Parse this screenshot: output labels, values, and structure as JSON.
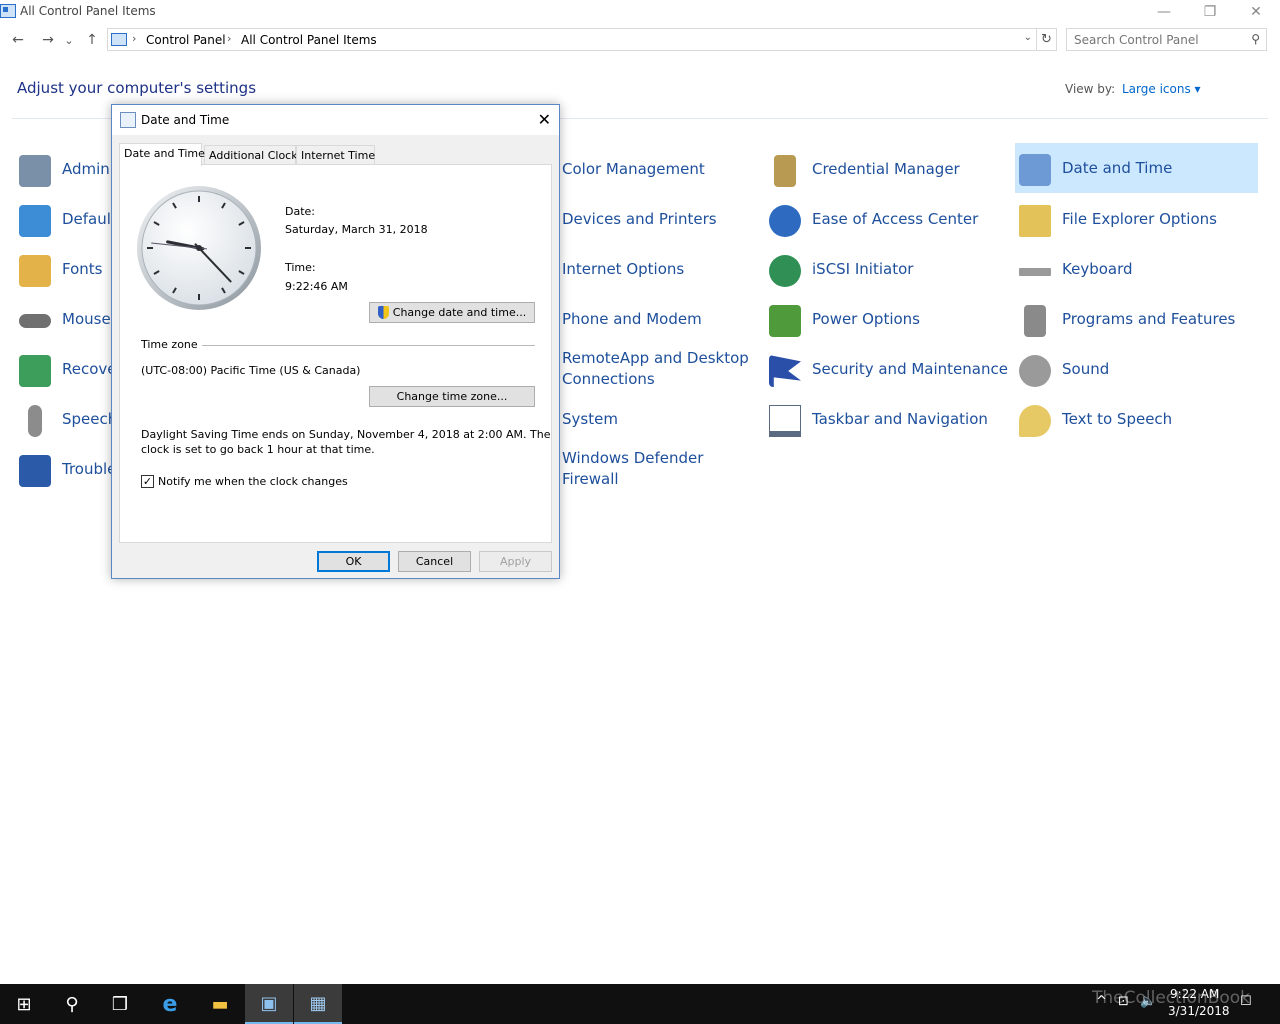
{
  "window": {
    "title": "All Control Panel Items",
    "minimize_glyph": "—",
    "restore_glyph": "❐",
    "close_glyph": "✕"
  },
  "nav": {
    "back_glyph": "←",
    "forward_glyph": "→",
    "recent_glyph": "⌄",
    "up_glyph": "↑",
    "breadcrumbs": [
      "Control Panel",
      "All Control Panel Items"
    ],
    "separator": "›",
    "refresh_glyph": "↻",
    "search_placeholder": "Search Control Panel",
    "search_glyph": "⚲"
  },
  "content": {
    "heading": "Adjust your computer's settings",
    "view_by_label": "View by:",
    "view_by_value": "Large icons ▾"
  },
  "items_col1": [
    {
      "label": "Admini",
      "color": "#7a8fa8"
    },
    {
      "label": "Default",
      "color": "#3c8dd6"
    },
    {
      "label": "Fonts",
      "color": "#e3b34a"
    },
    {
      "label": "Mouse",
      "color": "#707070"
    },
    {
      "label": "Recove",
      "color": "#3d9e5c"
    },
    {
      "label": "Speech",
      "color": "#8c8c8c"
    },
    {
      "label": "Trouble",
      "color": "#2a5aa8"
    }
  ],
  "items_col3": [
    {
      "label": "Color Management",
      "color": "#d0d0d0"
    },
    {
      "label": "Devices and Printers",
      "color": "#d0d0d0"
    },
    {
      "label": "Internet Options",
      "color": "#d0d0d0"
    },
    {
      "label": "Phone and Modem",
      "color": "#d0d0d0"
    },
    {
      "label": "RemoteApp and Desktop",
      "label2": "Connections",
      "color": "#d0d0d0"
    },
    {
      "label": "System",
      "color": "#d0d0d0"
    },
    {
      "label": "Windows Defender",
      "label2": "Firewall",
      "color": "#d0d0d0"
    }
  ],
  "items_col4": [
    {
      "label": "Credential Manager",
      "color": "#b89a52"
    },
    {
      "label": "Ease of Access Center",
      "color": "#2e6bc0"
    },
    {
      "label": "iSCSI Initiator",
      "color": "#2f8f55"
    },
    {
      "label": "Power Options",
      "color": "#4f9a3a"
    },
    {
      "label": "Security and Maintenance",
      "color": "#2a4fa8"
    },
    {
      "label": "Taskbar and Navigation",
      "color": "#5a6a80"
    }
  ],
  "items_col5": [
    {
      "label": "Date and Time",
      "color": "#6d9ad4"
    },
    {
      "label": "File Explorer Options",
      "color": "#e3c25a"
    },
    {
      "label": "Keyboard",
      "color": "#9a9a9a"
    },
    {
      "label": "Programs and Features",
      "color": "#8a8a8a"
    },
    {
      "label": "Sound",
      "color": "#9a9a9a"
    },
    {
      "label": "Text to Speech",
      "color": "#e6c864"
    }
  ],
  "dialog": {
    "title": "Date and Time",
    "close_glyph": "✕",
    "tabs": [
      "Date and Time",
      "Additional Clocks",
      "Internet Time"
    ],
    "date_label": "Date:",
    "date_value": "Saturday, March 31, 2018",
    "time_label": "Time:",
    "time_value": "9:22:46 AM",
    "change_datetime_btn": "Change date and time...",
    "timezone_header": "Time zone",
    "timezone_value": "(UTC-08:00) Pacific Time (US & Canada)",
    "change_timezone_btn": "Change time zone...",
    "dst_line1": "Daylight Saving Time ends on Sunday, November 4, 2018 at 2:00 AM. The",
    "dst_line2": "clock is set to go back 1 hour at that time.",
    "notify_label": "Notify me when the clock changes",
    "notify_checked_glyph": "✓",
    "ok": "OK",
    "cancel": "Cancel",
    "apply": "Apply",
    "clock": {
      "hour": 9,
      "minute": 22,
      "second": 46
    }
  },
  "taskbar": {
    "start_glyph": "⊞",
    "search_glyph": "⚲",
    "taskview_glyph": "❒",
    "ie_glyph": "e",
    "explorer_glyph": "▬",
    "cp_glyph": "▣",
    "dt_glyph": "▦",
    "tray_glyphs": [
      "^",
      "⊡",
      "🔈",
      "☐"
    ],
    "clock_time": "9:22 AM",
    "clock_date": "3/31/2018",
    "watermark": "TheCollectionBook"
  }
}
